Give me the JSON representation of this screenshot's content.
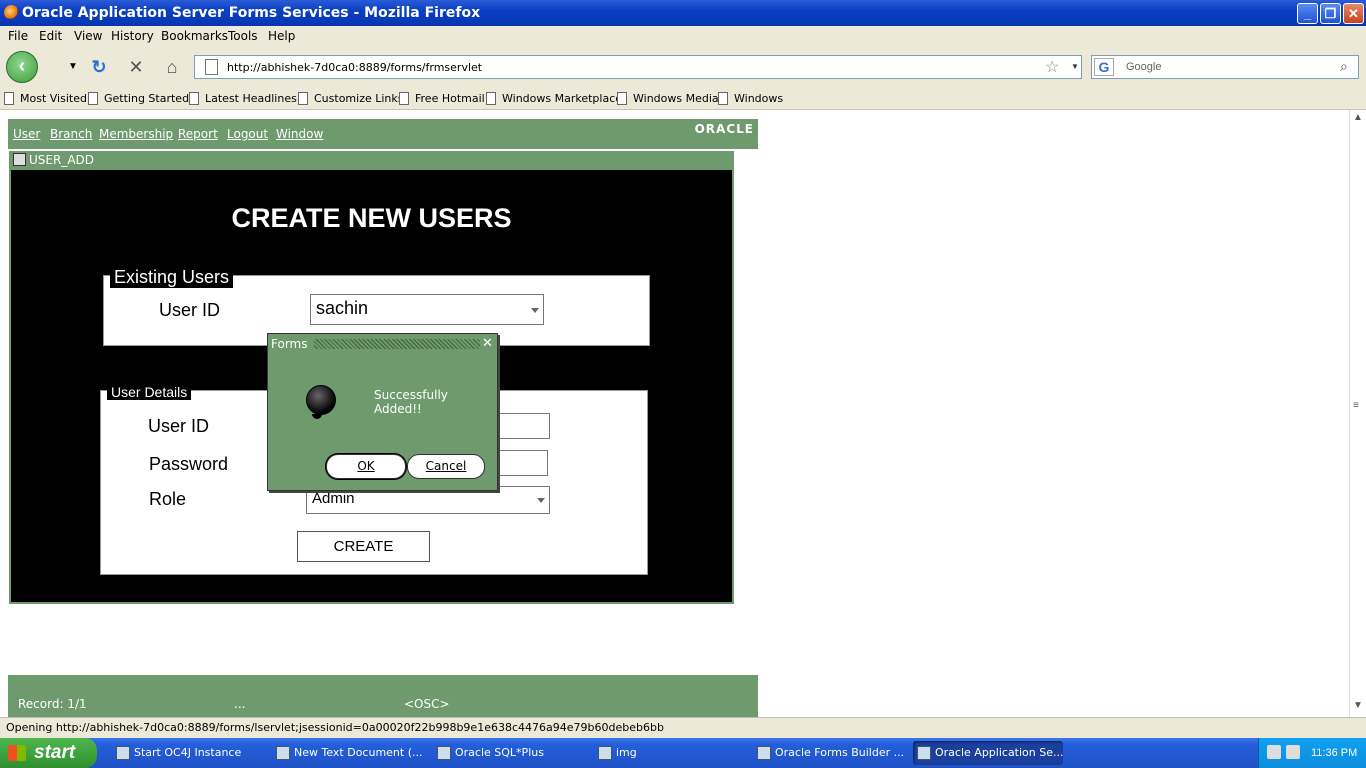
{
  "window": {
    "title": "Oracle Application Server Forms Services - Mozilla Firefox",
    "min": "_",
    "max": "❐",
    "close": "✕"
  },
  "menu": [
    "File",
    "Edit",
    "View",
    "History",
    "Bookmarks",
    "Tools",
    "Help"
  ],
  "nav": {
    "url": "http://abhishek-7d0ca0:8889/forms/frmservlet",
    "search_placeholder": "Google",
    "search_engine": "G"
  },
  "bookmarks": [
    "Most Visited",
    "Getting Started",
    "Latest Headlines",
    "Customize Links",
    "Free Hotmail",
    "Windows Marketplace",
    "Windows Media",
    "Windows"
  ],
  "applet": {
    "menu": [
      "User",
      "Branch",
      "Membership",
      "Report",
      "Logout",
      "Window"
    ],
    "logo": "ORACLE",
    "form_title": "USER_ADD",
    "heading": "CREATE NEW USERS",
    "existing": {
      "legend": "Existing Users",
      "user_id_label": "User ID",
      "user_id_value": "sachin"
    },
    "details": {
      "legend": "User Details",
      "user_id_label": "User ID",
      "password_label": "Password",
      "role_label": "Role",
      "role_value": "Admin",
      "create_label": "CREATE"
    },
    "dialog": {
      "title": "Forms",
      "message": "Successfully Added!!",
      "ok": "OK",
      "cancel": "Cancel"
    },
    "status": {
      "record": "Record: 1/1",
      "dots": "...",
      "osc": "<OSC>"
    }
  },
  "statusbar": "Opening http://abhishek-7d0ca0:8889/forms/lservlet;jsessionid=0a00020f22b998b9e1e638c4476a94e79b60debeb6bb",
  "taskbar": {
    "start": "start",
    "tasks": [
      "Start OC4J Instance",
      "New Text Document (...",
      "Oracle SQL*Plus",
      "img",
      "Oracle Forms Builder ...",
      "Oracle Application Se..."
    ],
    "clock": "11:36 PM"
  }
}
